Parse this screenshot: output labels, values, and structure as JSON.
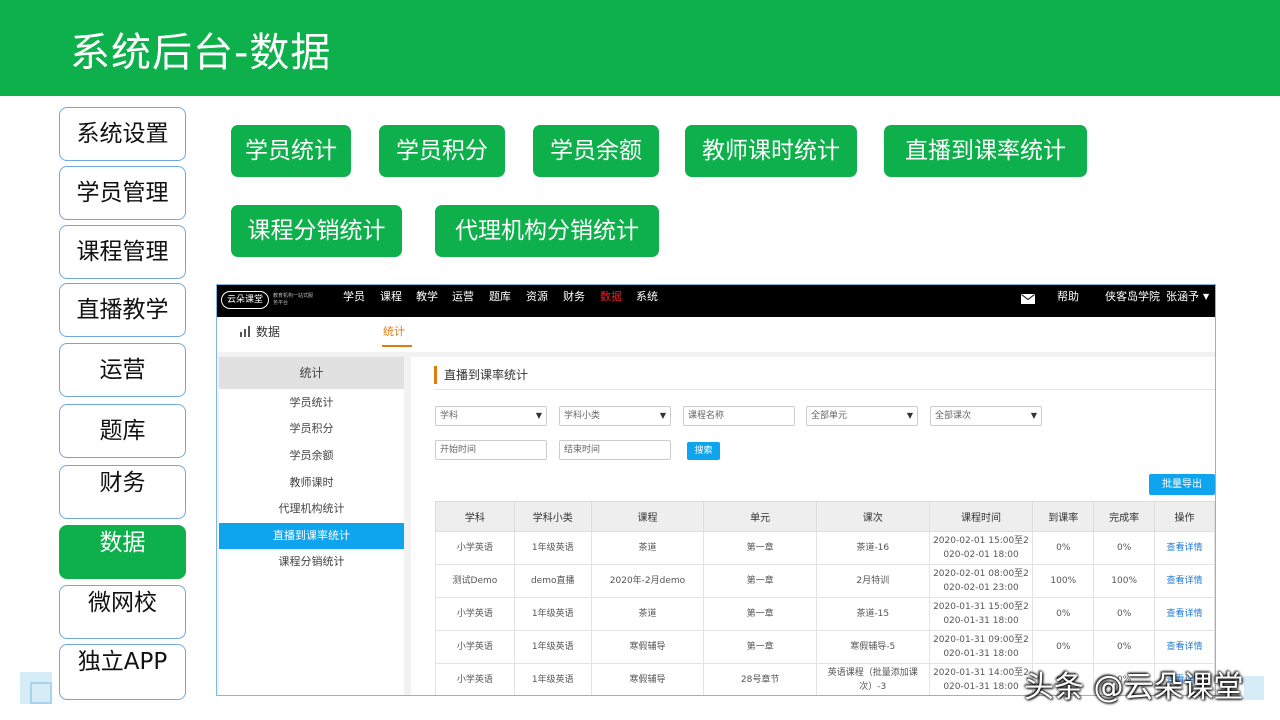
{
  "header": {
    "title": "系统后台-数据"
  },
  "left_nav": {
    "items": [
      {
        "label": "系统设置",
        "active": false
      },
      {
        "label": "学员管理",
        "active": false
      },
      {
        "label": "课程管理",
        "active": false
      },
      {
        "label": "直播教学",
        "active": false
      },
      {
        "label": "运营",
        "active": false
      },
      {
        "label": "题库",
        "active": false
      },
      {
        "label": "财务",
        "active": false
      },
      {
        "label": "数据",
        "active": true
      },
      {
        "label": "微网校",
        "active": false
      },
      {
        "label": "独立APP",
        "active": false
      }
    ]
  },
  "feature_buttons": [
    {
      "label": "学员统计"
    },
    {
      "label": "学员积分"
    },
    {
      "label": "学员余额"
    },
    {
      "label": "教师课时统计"
    },
    {
      "label": "直播到课率统计"
    },
    {
      "label": "课程分销统计"
    },
    {
      "label": "代理机构分销统计"
    }
  ],
  "app": {
    "logo": "云朵课堂",
    "logo_sub": "教育机构一站式服务平台",
    "top_nav": [
      {
        "label": "学员",
        "active": false
      },
      {
        "label": "课程",
        "active": false
      },
      {
        "label": "教学",
        "active": false
      },
      {
        "label": "运营",
        "active": false
      },
      {
        "label": "题库",
        "active": false
      },
      {
        "label": "资源",
        "active": false
      },
      {
        "label": "财务",
        "active": false
      },
      {
        "label": "数据",
        "active": true
      },
      {
        "label": "系统",
        "active": false
      }
    ],
    "help": "帮助",
    "school": "侠客岛学院",
    "user": "张涵予",
    "section_title": "数据",
    "section_tab": "统计",
    "sidebar": {
      "header": "统计",
      "items": [
        {
          "label": "学员统计",
          "active": false
        },
        {
          "label": "学员积分",
          "active": false
        },
        {
          "label": "学员余额",
          "active": false
        },
        {
          "label": "教师课时",
          "active": false
        },
        {
          "label": "代理机构统计",
          "active": false
        },
        {
          "label": "直播到课率统计",
          "active": true
        },
        {
          "label": "课程分销统计",
          "active": false
        }
      ]
    },
    "panel_title": "直播到课率统计",
    "filters": {
      "subject": "学科",
      "subject_sub": "学科小类",
      "course_name_placeholder": "课程名称",
      "unit": "全部单元",
      "lesson": "全部课次",
      "start_placeholder": "开始时间",
      "end_placeholder": "结束时间",
      "search": "搜索"
    },
    "export_label": "批量导出",
    "table": {
      "headers": [
        "学科",
        "学科小类",
        "课程",
        "单元",
        "课次",
        "课程时间",
        "到课率",
        "完成率",
        "操作"
      ],
      "rows": [
        [
          "小学英语",
          "1年级英语",
          "茶道",
          "第一章",
          "茶道-16",
          "2020-02-01 15:00至2 020-02-01 18:00",
          "0%",
          "0%",
          "查看详情"
        ],
        [
          "测试Demo",
          "demo直播",
          "2020年-2月demo",
          "第一章",
          "2月特训",
          "2020-02-01 08:00至2 020-02-01 23:00",
          "100%",
          "100%",
          "查看详情"
        ],
        [
          "小学英语",
          "1年级英语",
          "茶道",
          "第一章",
          "茶道-15",
          "2020-01-31 15:00至2 020-01-31 18:00",
          "0%",
          "0%",
          "查看详情"
        ],
        [
          "小学英语",
          "1年级英语",
          "寒假辅导",
          "第一章",
          "寒假辅导-5",
          "2020-01-31 09:00至2 020-01-31 18:00",
          "0%",
          "0%",
          "查看详情"
        ],
        [
          "小学英语",
          "1年级英语",
          "寒假辅导",
          "28号章节",
          "英语课程（批量添加课次）-3",
          "2020-01-31 14:00至2 020-01-31 18:00",
          "0%",
          "0%",
          "查看详情"
        ]
      ]
    }
  },
  "watermark": "头条 @云朵课堂"
}
